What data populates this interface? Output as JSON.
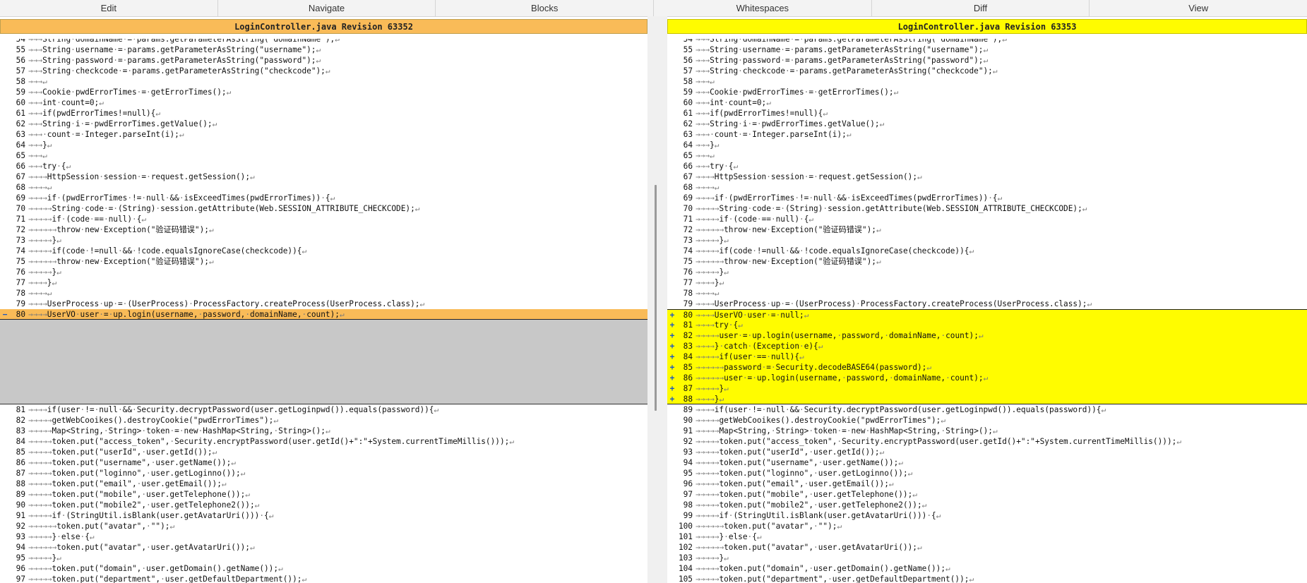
{
  "menu": [
    "Edit",
    "Navigate",
    "Blocks",
    "Whitespaces",
    "Diff",
    "View"
  ],
  "headers": {
    "left": "LoginController.java Revision 63352",
    "right": "LoginController.java Revision 63353"
  },
  "colors": {
    "left_change": "#f9bb58",
    "right_change": "#fffc00",
    "filler": "#c8c8c8"
  },
  "left": {
    "before": [
      {
        "n": "54",
        "t": "→→→String·domainName·=·params.getParameterAsString(\"domainName\");↵"
      },
      {
        "n": "55",
        "t": "→→→String·username·=·params.getParameterAsString(\"username\");↵"
      },
      {
        "n": "56",
        "t": "→→→String·password·=·params.getParameterAsString(\"password\");↵"
      },
      {
        "n": "57",
        "t": "→→→String·checkcode·=·params.getParameterAsString(\"checkcode\");↵"
      },
      {
        "n": "58",
        "t": "→→→↵"
      },
      {
        "n": "59",
        "t": "→→→Cookie·pwdErrorTimes·=·getErrorTimes();↵"
      },
      {
        "n": "60",
        "t": "→→→int·count=0;↵"
      },
      {
        "n": "61",
        "t": "→→→if(pwdErrorTimes!=null){↵"
      },
      {
        "n": "62",
        "t": "→→→String·i·=·pwdErrorTimes.getValue();↵"
      },
      {
        "n": "63",
        "t": "→→→·count·=·Integer.parseInt(i);↵"
      },
      {
        "n": "64",
        "t": "→→→}↵"
      },
      {
        "n": "65",
        "t": "→→→↵"
      },
      {
        "n": "66",
        "t": "→→→try·{↵"
      },
      {
        "n": "67",
        "t": "→→→→HttpSession·session·=·request.getSession();↵"
      },
      {
        "n": "68",
        "t": "→→→→↵"
      },
      {
        "n": "69",
        "t": "→→→→if·(pwdErrorTimes·!=·null·&&·isExceedTimes(pwdErrorTimes))·{↵"
      },
      {
        "n": "70",
        "t": "→→→→→String·code·=·(String)·session.getAttribute(Web.SESSION_ATTRIBUTE_CHECKCODE);↵"
      },
      {
        "n": "71",
        "t": "→→→→→if·(code·==·null)·{↵"
      },
      {
        "n": "72",
        "t": "→→→→→→throw·new·Exception(\"验证码错误\");↵"
      },
      {
        "n": "73",
        "t": "→→→→→}↵"
      },
      {
        "n": "74",
        "t": "→→→→→if(code·!=null·&&·!code.equalsIgnoreCase(checkcode)){↵"
      },
      {
        "n": "75",
        "t": "→→→→→→throw·new·Exception(\"验证码错误\");↵"
      },
      {
        "n": "76",
        "t": "→→→→→}↵"
      },
      {
        "n": "77",
        "t": "→→→→}↵"
      },
      {
        "n": "78",
        "t": "→→→→↵"
      },
      {
        "n": "79",
        "t": "→→→→UserProcess·up·=·(UserProcess)·ProcessFactory.createProcess(UserProcess.class);↵"
      }
    ],
    "changed": [
      {
        "m": "−",
        "n": "80",
        "t": "→→→→UserVO·user·=·up.login(username,·password,·domainName,·count);↵"
      }
    ],
    "after": [
      {
        "n": "81",
        "t": "→→→→if(user·!=·null·&&·Security.decryptPassword(user.getLoginpwd()).equals(password)){↵"
      },
      {
        "n": "82",
        "t": "→→→→→getWebCooikes().destroyCookie(\"pwdErrorTimes\");↵"
      },
      {
        "n": "83",
        "t": "→→→→→Map<String,·String>·token·=·new·HashMap<String,·String>();↵"
      },
      {
        "n": "84",
        "t": "→→→→→token.put(\"access_token\",·Security.encryptPassword(user.getId()+\":\"+System.currentTimeMillis()));↵"
      },
      {
        "n": "85",
        "t": "→→→→→token.put(\"userId\",·user.getId());↵"
      },
      {
        "n": "86",
        "t": "→→→→→token.put(\"username\",·user.getName());↵"
      },
      {
        "n": "87",
        "t": "→→→→→token.put(\"loginno\",·user.getLoginno());↵"
      },
      {
        "n": "88",
        "t": "→→→→→token.put(\"email\",·user.getEmail());↵"
      },
      {
        "n": "89",
        "t": "→→→→→token.put(\"mobile\",·user.getTelephone());↵"
      },
      {
        "n": "90",
        "t": "→→→→→token.put(\"mobile2\",·user.getTelephone2());↵"
      },
      {
        "n": "91",
        "t": "→→→→→if·(StringUtil.isBlank(user.getAvatarUri()))·{↵"
      },
      {
        "n": "92",
        "t": "→→→→→→token.put(\"avatar\",·\"\");↵"
      },
      {
        "n": "93",
        "t": "→→→→→}·else·{↵"
      },
      {
        "n": "94",
        "t": "→→→→→→token.put(\"avatar\",·user.getAvatarUri());↵"
      },
      {
        "n": "95",
        "t": "→→→→→}↵"
      },
      {
        "n": "96",
        "t": "→→→→→token.put(\"domain\",·user.getDomain().getName());↵"
      },
      {
        "n": "97",
        "t": "→→→→→token.put(\"department\",·user.getDefaultDepartment());↵"
      }
    ]
  },
  "right": {
    "before": [
      {
        "n": "54",
        "t": "→→→String·domainName·=·params.getParameterAsString(\"domainName\");↵"
      },
      {
        "n": "55",
        "t": "→→→String·username·=·params.getParameterAsString(\"username\");↵"
      },
      {
        "n": "56",
        "t": "→→→String·password·=·params.getParameterAsString(\"password\");↵"
      },
      {
        "n": "57",
        "t": "→→→String·checkcode·=·params.getParameterAsString(\"checkcode\");↵"
      },
      {
        "n": "58",
        "t": "→→→↵"
      },
      {
        "n": "59",
        "t": "→→→Cookie·pwdErrorTimes·=·getErrorTimes();↵"
      },
      {
        "n": "60",
        "t": "→→→int·count=0;↵"
      },
      {
        "n": "61",
        "t": "→→→if(pwdErrorTimes!=null){↵"
      },
      {
        "n": "62",
        "t": "→→→String·i·=·pwdErrorTimes.getValue();↵"
      },
      {
        "n": "63",
        "t": "→→→·count·=·Integer.parseInt(i);↵"
      },
      {
        "n": "64",
        "t": "→→→}↵"
      },
      {
        "n": "65",
        "t": "→→→↵"
      },
      {
        "n": "66",
        "t": "→→→try·{↵"
      },
      {
        "n": "67",
        "t": "→→→→HttpSession·session·=·request.getSession();↵"
      },
      {
        "n": "68",
        "t": "→→→→↵"
      },
      {
        "n": "69",
        "t": "→→→→if·(pwdErrorTimes·!=·null·&&·isExceedTimes(pwdErrorTimes))·{↵"
      },
      {
        "n": "70",
        "t": "→→→→→String·code·=·(String)·session.getAttribute(Web.SESSION_ATTRIBUTE_CHECKCODE);↵"
      },
      {
        "n": "71",
        "t": "→→→→→if·(code·==·null)·{↵"
      },
      {
        "n": "72",
        "t": "→→→→→→throw·new·Exception(\"验证码错误\");↵"
      },
      {
        "n": "73",
        "t": "→→→→→}↵"
      },
      {
        "n": "74",
        "t": "→→→→→if(code·!=null·&&·!code.equalsIgnoreCase(checkcode)){↵"
      },
      {
        "n": "75",
        "t": "→→→→→→throw·new·Exception(\"验证码错误\");↵"
      },
      {
        "n": "76",
        "t": "→→→→→}↵"
      },
      {
        "n": "77",
        "t": "→→→→}↵"
      },
      {
        "n": "78",
        "t": "→→→→↵"
      },
      {
        "n": "79",
        "t": "→→→→UserProcess·up·=·(UserProcess)·ProcessFactory.createProcess(UserProcess.class);↵"
      }
    ],
    "changed": [
      {
        "m": "+",
        "n": "80",
        "t": "→→→→UserVO·user·=·null;↵"
      },
      {
        "m": "+",
        "n": "81",
        "t": "→→→→try·{↵"
      },
      {
        "m": "+",
        "n": "82",
        "t": "→→→→→user·=·up.login(username,·password,·domainName,·count);↵"
      },
      {
        "m": "+",
        "n": "83",
        "t": "→→→→}·catch·(Exception·e){↵"
      },
      {
        "m": "+",
        "n": "84",
        "t": "→→→→→if(user·==·null){↵"
      },
      {
        "m": "+",
        "n": "85",
        "t": "→→→→→→password·=·Security.decodeBASE64(password);↵"
      },
      {
        "m": "+",
        "n": "86",
        "t": "→→→→→→user·=·up.login(username,·password,·domainName,·count);↵"
      },
      {
        "m": "+",
        "n": "87",
        "t": "→→→→→}↵"
      },
      {
        "m": "+",
        "n": "88",
        "t": "→→→→}↵"
      }
    ],
    "after": [
      {
        "n": "89",
        "t": "→→→→if(user·!=·null·&&·Security.decryptPassword(user.getLoginpwd()).equals(password)){↵"
      },
      {
        "n": "90",
        "t": "→→→→→getWebCooikes().destroyCookie(\"pwdErrorTimes\");↵"
      },
      {
        "n": "91",
        "t": "→→→→→Map<String,·String>·token·=·new·HashMap<String,·String>();↵"
      },
      {
        "n": "92",
        "t": "→→→→→token.put(\"access_token\",·Security.encryptPassword(user.getId()+\":\"+System.currentTimeMillis()));↵"
      },
      {
        "n": "93",
        "t": "→→→→→token.put(\"userId\",·user.getId());↵"
      },
      {
        "n": "94",
        "t": "→→→→→token.put(\"username\",·user.getName());↵"
      },
      {
        "n": "95",
        "t": "→→→→→token.put(\"loginno\",·user.getLoginno());↵"
      },
      {
        "n": "96",
        "t": "→→→→→token.put(\"email\",·user.getEmail());↵"
      },
      {
        "n": "97",
        "t": "→→→→→token.put(\"mobile\",·user.getTelephone());↵"
      },
      {
        "n": "98",
        "t": "→→→→→token.put(\"mobile2\",·user.getTelephone2());↵"
      },
      {
        "n": "99",
        "t": "→→→→→if·(StringUtil.isBlank(user.getAvatarUri()))·{↵"
      },
      {
        "n": "100",
        "t": "→→→→→→token.put(\"avatar\",·\"\");↵"
      },
      {
        "n": "101",
        "t": "→→→→→}·else·{↵"
      },
      {
        "n": "102",
        "t": "→→→→→→token.put(\"avatar\",·user.getAvatarUri());↵"
      },
      {
        "n": "103",
        "t": "→→→→→}↵"
      },
      {
        "n": "104",
        "t": "→→→→→token.put(\"domain\",·user.getDomain().getName());↵"
      },
      {
        "n": "105",
        "t": "→→→→→token.put(\"department\",·user.getDefaultDepartment());↵"
      }
    ]
  }
}
